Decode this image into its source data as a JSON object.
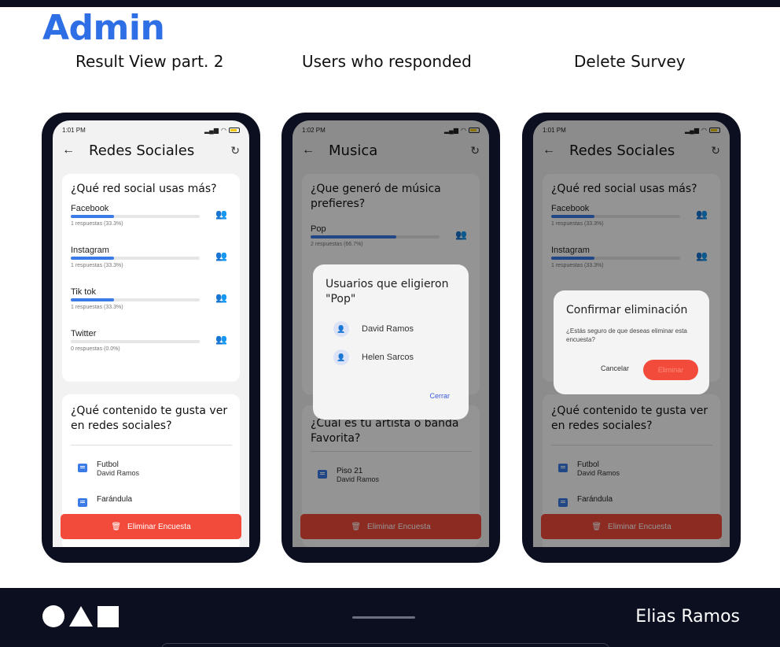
{
  "header": {
    "title": "Admin",
    "captions": [
      "Result View part. 2",
      "Users who responded",
      "Delete Survey"
    ]
  },
  "colors": {
    "accent": "#2f6fe6",
    "progress": "#3b7be8",
    "danger": "#f24b3b",
    "footer": "#0b0f1f"
  },
  "phones": [
    {
      "time": "1:01 PM",
      "title": "Redes Sociales",
      "q1": {
        "title": "¿Qué red social usas más?",
        "options": [
          {
            "label": "Facebook",
            "count": "1 respuestas (33.3%)",
            "fraction": 0.333
          },
          {
            "label": "Instagram",
            "count": "1 respuestas (33.3%)",
            "fraction": 0.333
          },
          {
            "label": "Tik tok",
            "count": "1 respuestas (33.3%)",
            "fraction": 0.333
          },
          {
            "label": "Twitter",
            "count": "0 respuestas (0.0%)",
            "fraction": 0.0
          }
        ]
      },
      "q2": {
        "title": "¿Qué contenido te gusta ver en redes sociales?",
        "responses": [
          {
            "answer": "Futbol",
            "user": "David Ramos"
          },
          {
            "answer": "Farándula",
            "user": ""
          }
        ]
      },
      "delete_label": "Eliminar Encuesta"
    },
    {
      "time": "1:02 PM",
      "title": "Musica",
      "q1": {
        "title": "¿Que generó de música prefieres?",
        "options": [
          {
            "label": "Pop",
            "count": "2 respuestas (66.7%)",
            "fraction": 0.667
          }
        ]
      },
      "q2": {
        "title": "¿Cuál es tu artista o banda Favorita?",
        "responses": [
          {
            "answer": "Piso 21",
            "user": "David Ramos"
          }
        ]
      },
      "delete_label": "Eliminar Encuesta",
      "dialog": {
        "title": "Usuarios que eligieron \"Pop\"",
        "users": [
          "David Ramos",
          "Helen Sarcos"
        ],
        "close_label": "Cerrar"
      }
    },
    {
      "time": "1:01 PM",
      "title": "Redes Sociales",
      "q1": {
        "title": "¿Qué red social usas más?",
        "options": [
          {
            "label": "Facebook",
            "count": "1 respuestas (33.3%)",
            "fraction": 0.333
          },
          {
            "label": "Instagram",
            "count": "1 respuestas (33.3%)",
            "fraction": 0.333
          }
        ]
      },
      "q2": {
        "title": "¿Qué contenido te gusta ver en redes sociales?",
        "responses": [
          {
            "answer": "Futbol",
            "user": "David Ramos"
          },
          {
            "answer": "Farándula",
            "user": ""
          }
        ]
      },
      "delete_label": "Eliminar Encuesta",
      "dialog": {
        "title": "Confirmar eliminación",
        "message": "¿Estás seguro de que deseas eliminar esta encuesta?",
        "cancel_label": "Cancelar",
        "confirm_label": "Eliminar"
      }
    }
  ],
  "footer": {
    "author": "Elias Ramos"
  }
}
